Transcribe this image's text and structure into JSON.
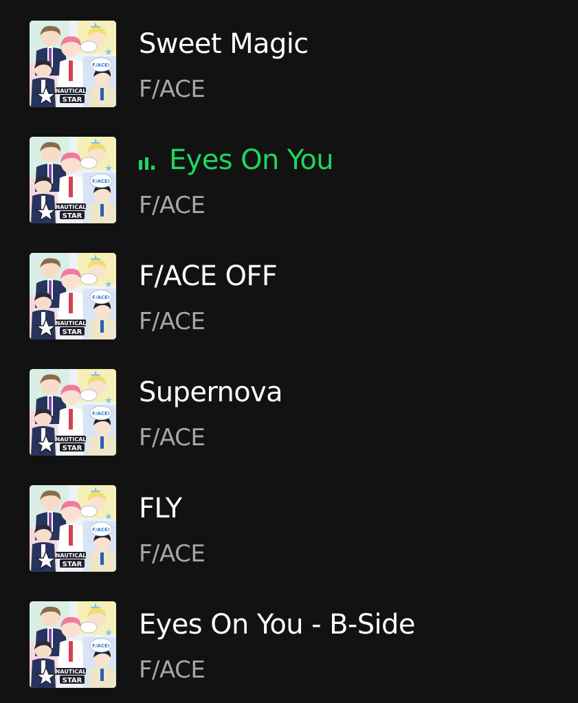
{
  "tracks": [
    {
      "title": "Sweet Magic",
      "artist": "F/ACE",
      "playing": false
    },
    {
      "title": "Eyes On You",
      "artist": "F/ACE",
      "playing": true
    },
    {
      "title": "F/ACE OFF",
      "artist": "F/ACE",
      "playing": false
    },
    {
      "title": "Supernova",
      "artist": "F/ACE",
      "playing": false
    },
    {
      "title": "FLY",
      "artist": "F/ACE",
      "playing": false
    },
    {
      "title": "Eyes On You - B-Side",
      "artist": "F/ACE",
      "playing": false
    }
  ],
  "cover": {
    "icon": "album-cover-art",
    "logo_line1": "NAUTICAL",
    "logo_line2": "STAR",
    "bubble_text": "F/ACE!"
  },
  "colors": {
    "background": "#121212",
    "title": "#ffffff",
    "artist": "#a7a7a7",
    "playing_accent": "#1ed760"
  },
  "now_playing_icon": "equalizer-bars-icon"
}
